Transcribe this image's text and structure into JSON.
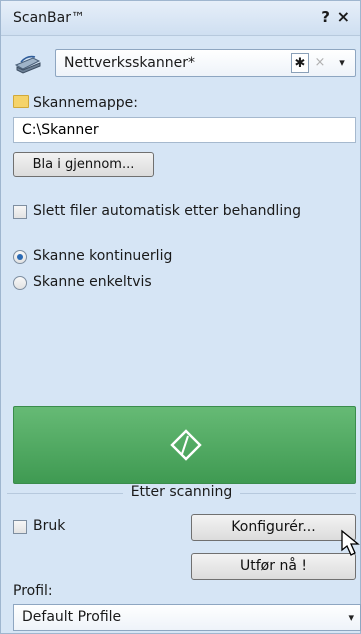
{
  "window": {
    "title": "ScanBar™",
    "help_label": "?",
    "close_label": "×"
  },
  "scanner": {
    "icon": "scanner-icon",
    "selected": "Nettverksskanner*",
    "star_label": "✱",
    "clear_label": "×",
    "dropdown_icon": "▾"
  },
  "folder": {
    "icon": "folder-icon",
    "label": "Skannemappe:",
    "value": "C:\\Skanner",
    "browse_label": "Bla i gjennom..."
  },
  "options": {
    "auto_delete": {
      "label": "Slett filer automatisk etter behandling",
      "checked": false
    },
    "scan_mode": {
      "selected": "continuous",
      "continuous_label": "Skanne kontinuerlig",
      "single_label": "Skanne enkeltvis"
    }
  },
  "scan_button": {
    "icon": "scan-icon",
    "color": "#4caa5e"
  },
  "after_scan": {
    "header": "Etter scanning",
    "use_label": "Bruk",
    "use_checked": false,
    "configure_label": "Konfigurér...",
    "execute_label": "Utfør nå !"
  },
  "profile": {
    "label": "Profil:",
    "selected": "Default Profile",
    "dropdown_icon": "▾"
  }
}
